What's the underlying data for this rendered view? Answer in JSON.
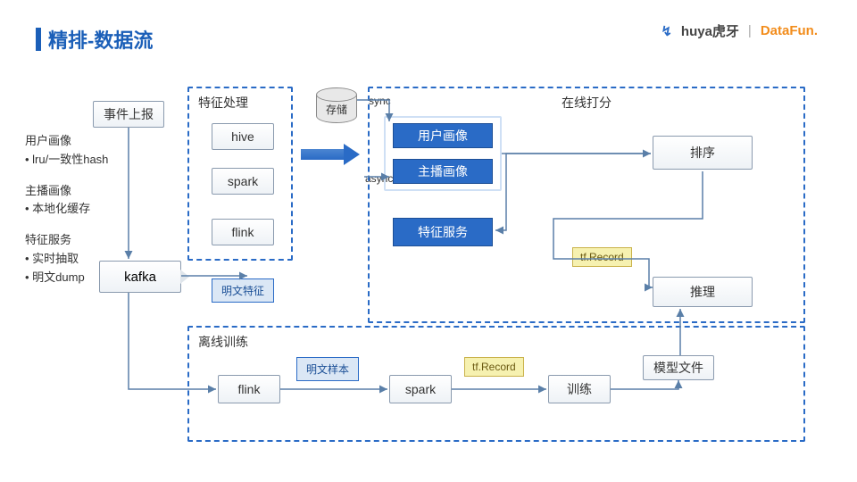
{
  "title": "精排-数据流",
  "logos": {
    "huya": "huya虎牙",
    "sep": "|",
    "datafun": "DataFun."
  },
  "notes": {
    "g1": {
      "h": "用户画像",
      "b": "• lru/一致性hash"
    },
    "g2": {
      "h": "主播画像",
      "b": "• 本地化缓存"
    },
    "g3": {
      "h": "特征服务",
      "b1": "• 实时抽取",
      "b2": "• 明文dump"
    }
  },
  "nodes": {
    "event": "事件上报",
    "kafka": "kafka",
    "fp": {
      "title": "特征处理",
      "hive": "hive",
      "spark": "spark",
      "flink": "flink"
    },
    "storage": "存储",
    "sync": "sync",
    "async": "async",
    "online": {
      "title": "在线打分",
      "user": "用户画像",
      "anchor": "主播画像",
      "feat": "特征服务",
      "rank": "排序",
      "infer": "推理"
    },
    "tag_feat": "明文特征",
    "tf1": "tf.Record",
    "offline": {
      "title": "离线训练",
      "flink": "flink",
      "spark": "spark",
      "train": "训练",
      "model": "模型文件",
      "sample": "明文样本",
      "tf2": "tf.Record"
    }
  }
}
